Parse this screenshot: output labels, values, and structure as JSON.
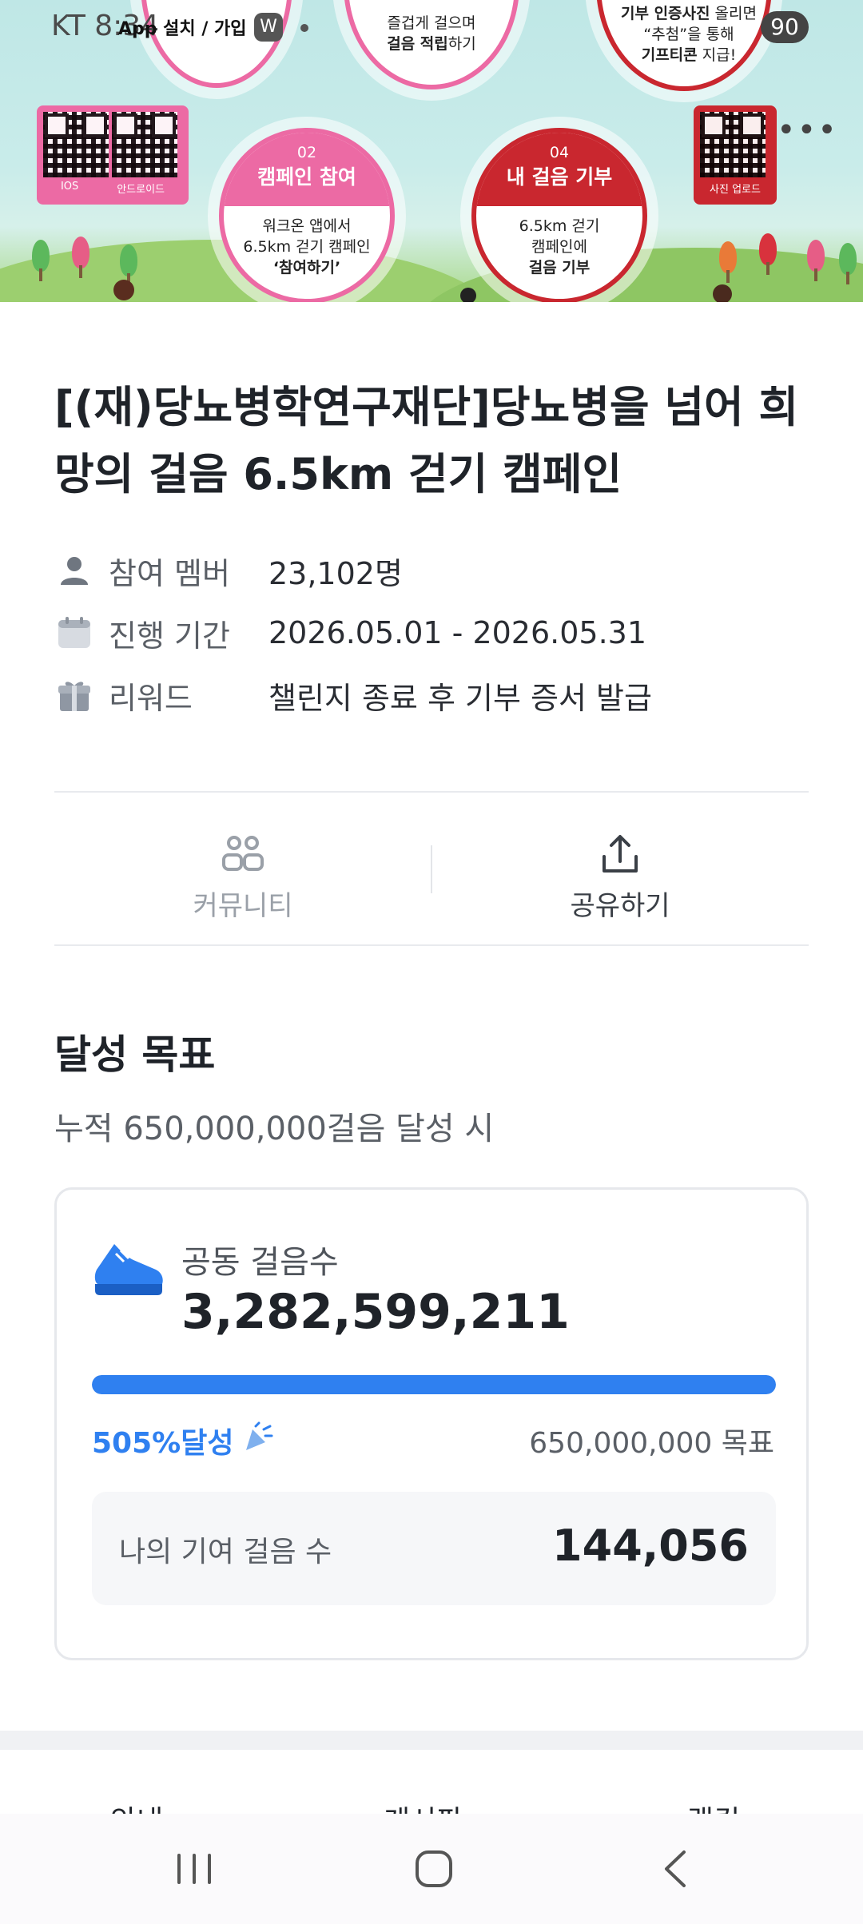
{
  "status_bar": {
    "carrier": "KT 8:34",
    "app_badge": "App 설치 / 가입",
    "w_badge": "W",
    "battery": "90"
  },
  "banner": {
    "top_center_text_line1": "즐겁게 걸으며",
    "top_center_text_line2_bold": "걸음 적립",
    "top_center_text_line2_rest": "하기",
    "top_right_text_line1_bold": "기부 인증사진",
    "top_right_text_line1_rest": " 올리면",
    "top_right_text_line2": "“추첨”을 통해",
    "top_right_text_line3_bold": "기프티콘",
    "top_right_text_line3_rest": " 지급!",
    "qr_left_labels": [
      "IOS",
      "안드로이드"
    ],
    "qr_right_label": "사진 업로드",
    "step2": {
      "num": "02",
      "head": "캠페인 참여",
      "body1": "워크온 앱에서",
      "body2": "6.5km 걷기 캠페인",
      "body3": "‘참여하기’"
    },
    "step4": {
      "num": "04",
      "head": "내 걸음 기부",
      "body1": "6.5km 걷기",
      "body2": "캠페인에",
      "body3": "걸음 기부"
    },
    "more_icon": "more-dots-icon"
  },
  "campaign": {
    "title": "[(재)당뇨병학연구재단]당뇨병을 넘어 희망의 걸음 6.5km 걷기 캠페인",
    "info": [
      {
        "icon": "person-icon",
        "label": "참여 멤버",
        "value": "23,102명"
      },
      {
        "icon": "calendar-icon",
        "label": "진행 기간",
        "value": "2026.05.01 - 2026.05.31"
      },
      {
        "icon": "gift-icon",
        "label": "리워드",
        "value": "챌린지 종료 후 기부 증서 발급"
      }
    ]
  },
  "actions": {
    "community_label": "커뮤니티",
    "share_label": "공유하기"
  },
  "goal": {
    "heading": "달성 목표",
    "subtitle": "누적 650,000,000걸음 달성 시",
    "shared_steps_label": "공동 걸음수",
    "shared_steps_value": "3,282,599,211",
    "achieved_text": "505%달성",
    "achieved_fraction": 1.0,
    "target_text": "650,000,000 목표",
    "my_steps_label": "나의 기여 걸음 수",
    "my_steps_value": "144,056"
  },
  "tabs": [
    "안내",
    "게시판",
    "랭킹"
  ],
  "colors": {
    "accent_blue": "#2f80f0",
    "banner_pink": "#ec6aa4",
    "banner_red": "#c9272f"
  }
}
